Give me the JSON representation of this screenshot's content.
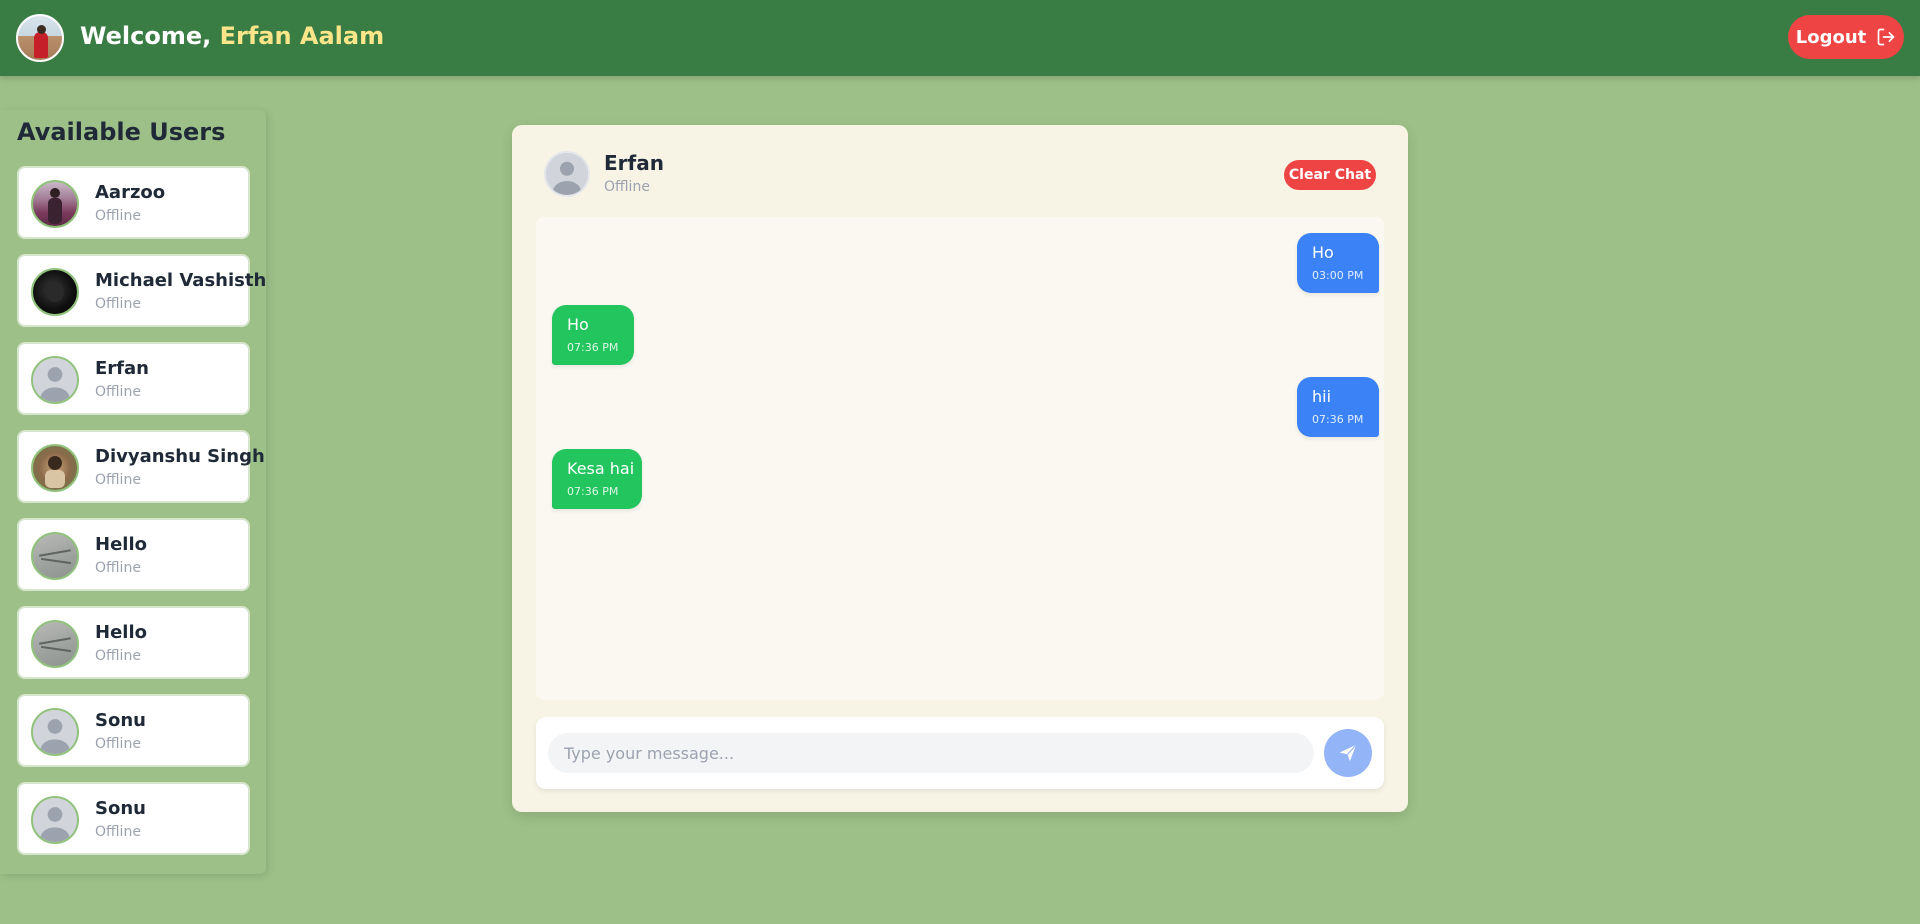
{
  "header": {
    "welcome_prefix": "Welcome, ",
    "user_name": "Erfan Aalam",
    "logout_label": "Logout"
  },
  "sidebar": {
    "title": "Available Users",
    "users": [
      {
        "name": "Aarzoo",
        "status": "Offline",
        "avatar": "photo"
      },
      {
        "name": "Michael Vashisth",
        "status": "Offline",
        "avatar": "photo"
      },
      {
        "name": "Erfan",
        "status": "Offline",
        "avatar": "default-user-icon"
      },
      {
        "name": "Divyanshu Singh",
        "status": "Offline",
        "avatar": "photo"
      },
      {
        "name": "Hello",
        "status": "Offline",
        "avatar": "photo"
      },
      {
        "name": "Hello",
        "status": "Offline",
        "avatar": "photo"
      },
      {
        "name": "Sonu",
        "status": "Offline",
        "avatar": "default-user-icon"
      },
      {
        "name": "Sonu",
        "status": "Offline",
        "avatar": "default-user-icon"
      }
    ]
  },
  "chat": {
    "contact_name": "Erfan",
    "contact_status": "Offline",
    "clear_label": "Clear Chat",
    "messages": [
      {
        "text": "Ho",
        "time": "03:00 PM",
        "direction": "sent"
      },
      {
        "text": "Ho",
        "time": "07:36 PM",
        "direction": "received"
      },
      {
        "text": "hii",
        "time": "07:36 PM",
        "direction": "sent"
      },
      {
        "text": "Kesa hai",
        "time": "07:36 PM",
        "direction": "received"
      }
    ],
    "input_placeholder": "Type your message...",
    "input_value": ""
  },
  "colors": {
    "background": "#9dc088",
    "header": "#3a7d44",
    "username_accent": "#fde68a",
    "danger": "#ef4444",
    "sent_bubble": "#3b82f6",
    "received_bubble": "#22c55e",
    "send_button": "#93b4f7"
  }
}
